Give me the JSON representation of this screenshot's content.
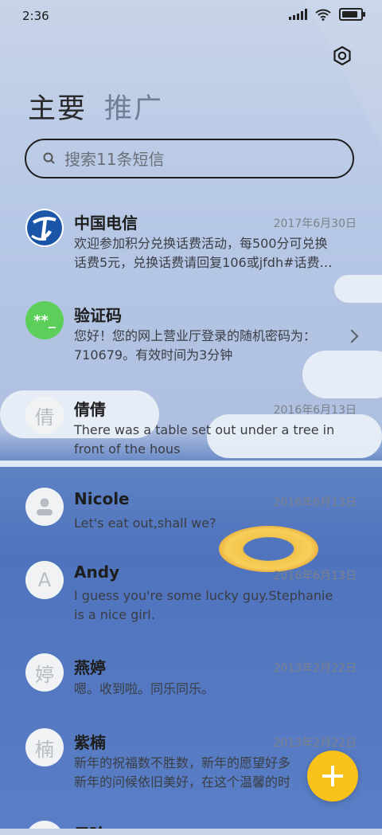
{
  "status_bar": {
    "time": "2:36"
  },
  "header": {
    "tabs": [
      {
        "label": "主要",
        "active": true
      },
      {
        "label": "推广",
        "active": false
      }
    ]
  },
  "search": {
    "placeholder": "搜索11条短信"
  },
  "conversations": [
    {
      "name": "中国电信",
      "date": "2017年6月30日",
      "preview_lines": [
        "欢迎参加积分兑换话费活动，每500分可兑换",
        "话费5元，兑换话费请回复106或jfdh#话费…"
      ],
      "avatar": "china-telecom-logo"
    },
    {
      "name": "验证码",
      "date": "",
      "preview_lines": [
        "您好！您的网上营业厅登录的随机密码为：",
        "710679。有效时间为3分钟"
      ],
      "avatar_text": "**_"
    },
    {
      "name": "倩倩",
      "date": "2016年6月13日",
      "preview_lines": [
        "There was a table set out under a tree in",
        "front of the hous"
      ],
      "avatar_text": "倩"
    },
    {
      "name": "Nicole",
      "date": "2016年6月13日",
      "preview_lines": [
        "Let's eat out,shall we?"
      ],
      "avatar": "person-icon"
    },
    {
      "name": "Andy",
      "date": "2016年6月13日",
      "preview_lines": [
        "I guess you're some lucky guy.Stephanie",
        "is a nice girl."
      ],
      "avatar_text": "A"
    },
    {
      "name": "燕婷",
      "date": "2013年2月22日",
      "preview_lines": [
        "嗯。收到啦。同乐同乐。"
      ],
      "avatar_text": "婷"
    },
    {
      "name": "紫楠",
      "date": "2013年2月22日",
      "preview_lines": [
        "新年的祝福数不胜数，新年的愿望好多",
        "新年的问候依旧美好，在这个温馨的时"
      ],
      "avatar_text": "楠"
    },
    {
      "name": "子玲",
      "date": "",
      "preview_lines": [],
      "avatar_text": ""
    }
  ],
  "colors": {
    "fab": "#f8c21b",
    "verify_avatar": "#5ccf5a",
    "telecom_blue": "#1b55a8"
  },
  "icons": {
    "settings": "settings-gear-icon",
    "search": "search-icon",
    "fab": "plus-icon"
  }
}
